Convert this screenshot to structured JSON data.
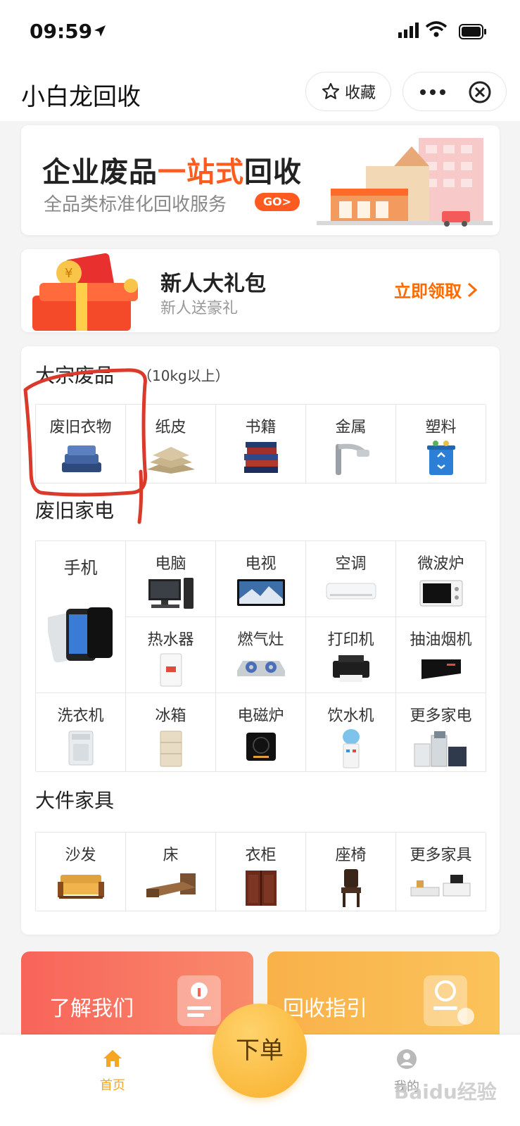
{
  "status_bar": {
    "time": "09:59"
  },
  "nav": {
    "app_title": "小白龙回收",
    "favorite_label": "收藏"
  },
  "banner": {
    "title_pre": "企业废品",
    "title_highlight": "一站式",
    "title_post": "回收",
    "subtitle": "全品类标准化回收服务",
    "go_label": "GO>"
  },
  "gift": {
    "title": "新人大礼包",
    "subtitle": "新人送豪礼",
    "cta": "立即领取"
  },
  "sections": {
    "bulk": {
      "title": "大宗废品",
      "note": "（10kg以上）",
      "items": [
        {
          "label": "废旧衣物",
          "icon": "clothes-pile-icon"
        },
        {
          "label": "纸皮",
          "icon": "cardboard-icon"
        },
        {
          "label": "书籍",
          "icon": "books-icon"
        },
        {
          "label": "金属",
          "icon": "metal-faucet-icon"
        },
        {
          "label": "塑料",
          "icon": "recycle-bin-icon"
        }
      ]
    },
    "appliances": {
      "title": "废旧家电",
      "items": [
        {
          "label": "手机",
          "icon": "phones-icon"
        },
        {
          "label": "电脑",
          "icon": "computer-icon"
        },
        {
          "label": "电视",
          "icon": "tv-icon"
        },
        {
          "label": "空调",
          "icon": "air-conditioner-icon"
        },
        {
          "label": "微波炉",
          "icon": "microwave-icon"
        },
        {
          "label": "热水器",
          "icon": "water-heater-icon"
        },
        {
          "label": "燃气灶",
          "icon": "gas-stove-icon"
        },
        {
          "label": "打印机",
          "icon": "printer-icon"
        },
        {
          "label": "抽油烟机",
          "icon": "range-hood-icon"
        },
        {
          "label": "洗衣机",
          "icon": "washing-machine-icon"
        },
        {
          "label": "冰箱",
          "icon": "fridge-icon"
        },
        {
          "label": "电磁炉",
          "icon": "induction-cooker-icon"
        },
        {
          "label": "饮水机",
          "icon": "water-dispenser-icon"
        },
        {
          "label": "更多家电",
          "icon": "more-appliances-icon"
        }
      ]
    },
    "furniture": {
      "title": "大件家具",
      "items": [
        {
          "label": "沙发",
          "icon": "sofa-icon"
        },
        {
          "label": "床",
          "icon": "bed-icon"
        },
        {
          "label": "衣柜",
          "icon": "wardrobe-icon"
        },
        {
          "label": "座椅",
          "icon": "chair-icon"
        },
        {
          "label": "更多家具",
          "icon": "more-furniture-icon"
        }
      ]
    }
  },
  "promos": {
    "about": "了解我们",
    "guide": "回收指引"
  },
  "tabbar": {
    "home": "首页",
    "order": "下单",
    "mine": "我的"
  },
  "watermark": "Baidu经验",
  "colors": {
    "accent": "#ff5a1f",
    "brand_orange": "#f5a623",
    "cta": "#ff6a00"
  }
}
